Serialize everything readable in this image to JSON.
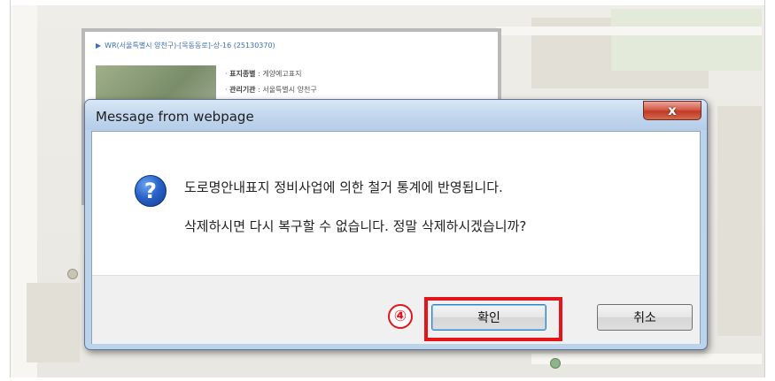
{
  "background": {
    "info_popup": {
      "title": "WR(서울특별시 양천구)-[목동동로]-상-16 (25130370)",
      "fields": [
        {
          "label": "표지종별",
          "value": "게양예고표지"
        },
        {
          "label": "관리기관",
          "value": "서울특별시 양천구"
        }
      ]
    }
  },
  "dialog": {
    "title": "Message from webpage",
    "close_label": "x",
    "icon": "question-icon",
    "icon_glyph": "?",
    "message_line1": "도로명안내표지 정비사업에 의한 철거 통계에 반영됩니다.",
    "message_line2": "삭제하시면 다시 복구할 수 없습니다. 정말 삭제하시겠습니까?",
    "ok_label": "확인",
    "cancel_label": "취소"
  },
  "annotation": {
    "step_label": "④",
    "highlight_color": "#e3141a"
  }
}
